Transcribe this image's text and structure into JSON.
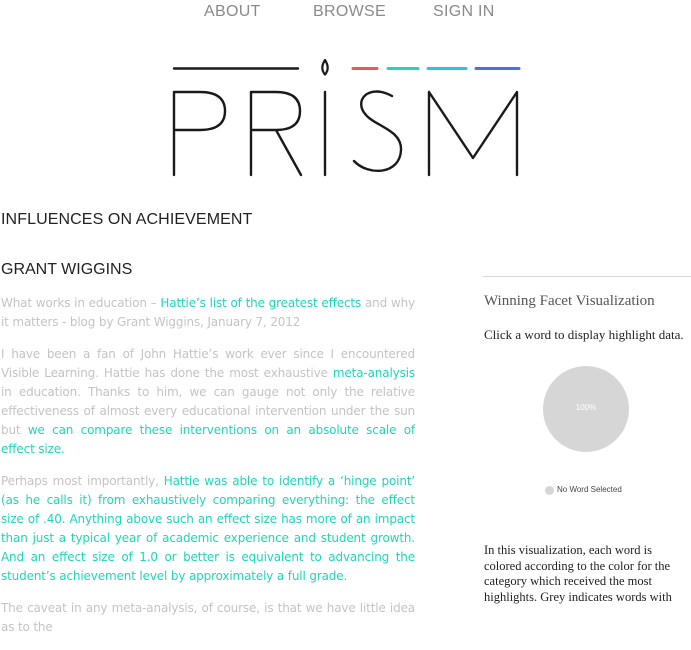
{
  "nav": {
    "items": [
      {
        "label": "ABOUT"
      },
      {
        "label": "BROWSE"
      },
      {
        "label": "SIGN IN"
      }
    ]
  },
  "logo": {
    "text": "PRISM",
    "colors": [
      "#e85a5a",
      "#2ad3b5",
      "#2ec2dd",
      "#4a73e0"
    ],
    "line_color": "#1a1a1a"
  },
  "page": {
    "title": "INFLUENCES ON ACHIEVEMENT",
    "author": "GRANT WIGGINS"
  },
  "article": {
    "highlight_color": "#1fd6b8",
    "paragraphs": [
      [
        {
          "text": "What works in education – ",
          "hl": false
        },
        {
          "text": "Hattie’s list of the greatest effects",
          "hl": true
        },
        {
          "text": " and why it matters - blog by Grant Wiggins, January 7, 2012",
          "hl": false
        }
      ],
      [
        {
          "text": "I have been a fan of John Hattie’s work ever since I encountered Visible Learning. Hattie has done the most exhaustive ",
          "hl": false
        },
        {
          "text": "meta-analysis",
          "hl": true
        },
        {
          "text": " in education. Thanks to him, we can gauge not only the relative effectiveness of almost every educational intervention under the sun but ",
          "hl": false
        },
        {
          "text": "we can compare these interventions on an absolute scale of effect size.",
          "hl": true
        }
      ],
      [
        {
          "text": "Perhaps most importantly, ",
          "hl": false
        },
        {
          "text": "Hattie was able to identify a ‘hinge point’ (as he calls it) from exhaustively comparing everything: the effect size of .40. Anything above such an effect size has more of an impact than just a typical year of academic experience and student growth. And an effect size of 1.0 or better is equivalent to advancing the student’s achievement level by approximately a full grade.",
          "hl": true
        }
      ],
      [
        {
          "text": "The caveat in any meta-analysis, of course, is that we have little idea as to the",
          "hl": false
        }
      ]
    ]
  },
  "panel": {
    "title": "Winning Facet Visualization",
    "instruction": "Click a word to display highlight data.",
    "pie_label": "100%",
    "pie_color": "#d6d6d6",
    "legend_label": "No Word Selected",
    "description": "In this visualization, each word is colored according to the color for the category which received the most highlights. Grey indicates words with"
  },
  "chart_data": {
    "type": "pie",
    "title": "",
    "labels": [
      "No Word Selected"
    ],
    "values": [
      100
    ],
    "colors": [
      "#d6d6d6"
    ]
  }
}
